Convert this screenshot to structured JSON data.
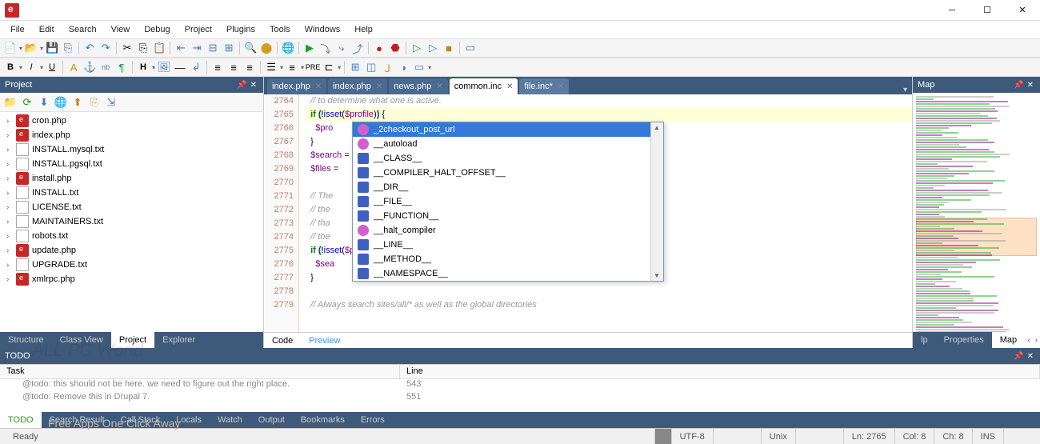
{
  "menubar": [
    "File",
    "Edit",
    "Search",
    "View",
    "Debug",
    "Project",
    "Plugins",
    "Tools",
    "Windows",
    "Help"
  ],
  "panels": {
    "project": "Project",
    "map": "Map",
    "todo": "TODO"
  },
  "project_toolbar_icons": [
    "folder-plus",
    "refresh",
    "arrow-down",
    "globe",
    "arrow-up",
    "copy",
    "export"
  ],
  "filetree": [
    {
      "name": "cron.php",
      "type": "php"
    },
    {
      "name": "index.php",
      "type": "php"
    },
    {
      "name": "INSTALL.mysql.txt",
      "type": "txt"
    },
    {
      "name": "INSTALL.pgsql.txt",
      "type": "txt"
    },
    {
      "name": "install.php",
      "type": "php"
    },
    {
      "name": "INSTALL.txt",
      "type": "txt"
    },
    {
      "name": "LICENSE.txt",
      "type": "txt"
    },
    {
      "name": "MAINTAINERS.txt",
      "type": "txt"
    },
    {
      "name": "robots.txt",
      "type": "txt"
    },
    {
      "name": "update.php",
      "type": "php"
    },
    {
      "name": "UPGRADE.txt",
      "type": "txt"
    },
    {
      "name": "xmlrpc.php",
      "type": "php"
    }
  ],
  "tabs": [
    {
      "label": "index.php",
      "active": false
    },
    {
      "label": "index.php",
      "active": false
    },
    {
      "label": "news.php",
      "active": false
    },
    {
      "label": "common.inc",
      "active": true
    },
    {
      "label": "file.inc*",
      "active": false,
      "star": true
    }
  ],
  "gutter_start": 2764,
  "code_lines": [
    {
      "t": "  // to determine what one is active.",
      "cls": "cm"
    },
    {
      "t": "  if (!isset($profile)) {",
      "hl": true,
      "php": true
    },
    {
      "t": "    $pro",
      "partial": true,
      "after": "');"
    },
    {
      "t": "  }"
    },
    {
      "t": "  $search =",
      "var": true
    },
    {
      "t": "  $files =",
      "var": true
    },
    {
      "t": ""
    },
    {
      "t": "  // The                                  tions of modules and",
      "cls": "cm"
    },
    {
      "t": "  // the                                  tine in the same way",
      "cls": "cm"
    },
    {
      "t": "  // tha                                  void changing anything",
      "cls": "cm"
    },
    {
      "t": "  // the                                  ectories.",
      "cls": "cm"
    },
    {
      "t": "  if (fi",
      "php": true
    },
    {
      "t": "    $sea",
      "var": true
    },
    {
      "t": "  }"
    },
    {
      "t": ""
    },
    {
      "t": "  // Always search sites/all/* as well as the global directories",
      "cls": "cm"
    }
  ],
  "autocomplete": [
    {
      "label": "_2checkout_post_url",
      "icon": "fn2",
      "sel": true
    },
    {
      "label": "__autoload",
      "icon": "fn2"
    },
    {
      "label": "__CLASS__",
      "icon": "magic"
    },
    {
      "label": "__COMPILER_HALT_OFFSET__",
      "icon": "magic"
    },
    {
      "label": "__DIR__",
      "icon": "magic"
    },
    {
      "label": "__FILE__",
      "icon": "magic"
    },
    {
      "label": "__FUNCTION__",
      "icon": "magic"
    },
    {
      "label": "__halt_compiler",
      "icon": "fn2"
    },
    {
      "label": "__LINE__",
      "icon": "magic"
    },
    {
      "label": "__METHOD__",
      "icon": "magic"
    },
    {
      "label": "__NAMESPACE__",
      "icon": "magic"
    }
  ],
  "left_bottom_tabs": [
    "Structure",
    "Class View",
    "Project",
    "Explorer"
  ],
  "left_bottom_active": "Project",
  "center_bottom_tabs": [
    "Code",
    "Preview"
  ],
  "center_bottom_active": "Code",
  "right_bottom_tabs": [
    "lp",
    "Properties",
    "Map"
  ],
  "right_bottom_active": "Map",
  "todo": {
    "columns": [
      "Task",
      "Line"
    ],
    "rows": [
      {
        "task": "@todo: this should not be here. we need to figure out the right place.",
        "line": "543"
      },
      {
        "task": "@todo: Remove this in Drupal 7.",
        "line": "551"
      }
    ]
  },
  "footer_tabs": [
    "TODO",
    "Search Result",
    "Call Stack",
    "Locals",
    "Watch",
    "Output",
    "Bookmarks",
    "Errors"
  ],
  "footer_active": "TODO",
  "status": {
    "ready": "Ready",
    "encoding": "UTF-8",
    "eol": "Unix",
    "line": "Ln: 2765",
    "col": "Col: 8",
    "ch": "Ch: 8",
    "ins": "INS"
  },
  "watermark": "Free Apps One Click Away",
  "watermark2": "ALL PC World"
}
